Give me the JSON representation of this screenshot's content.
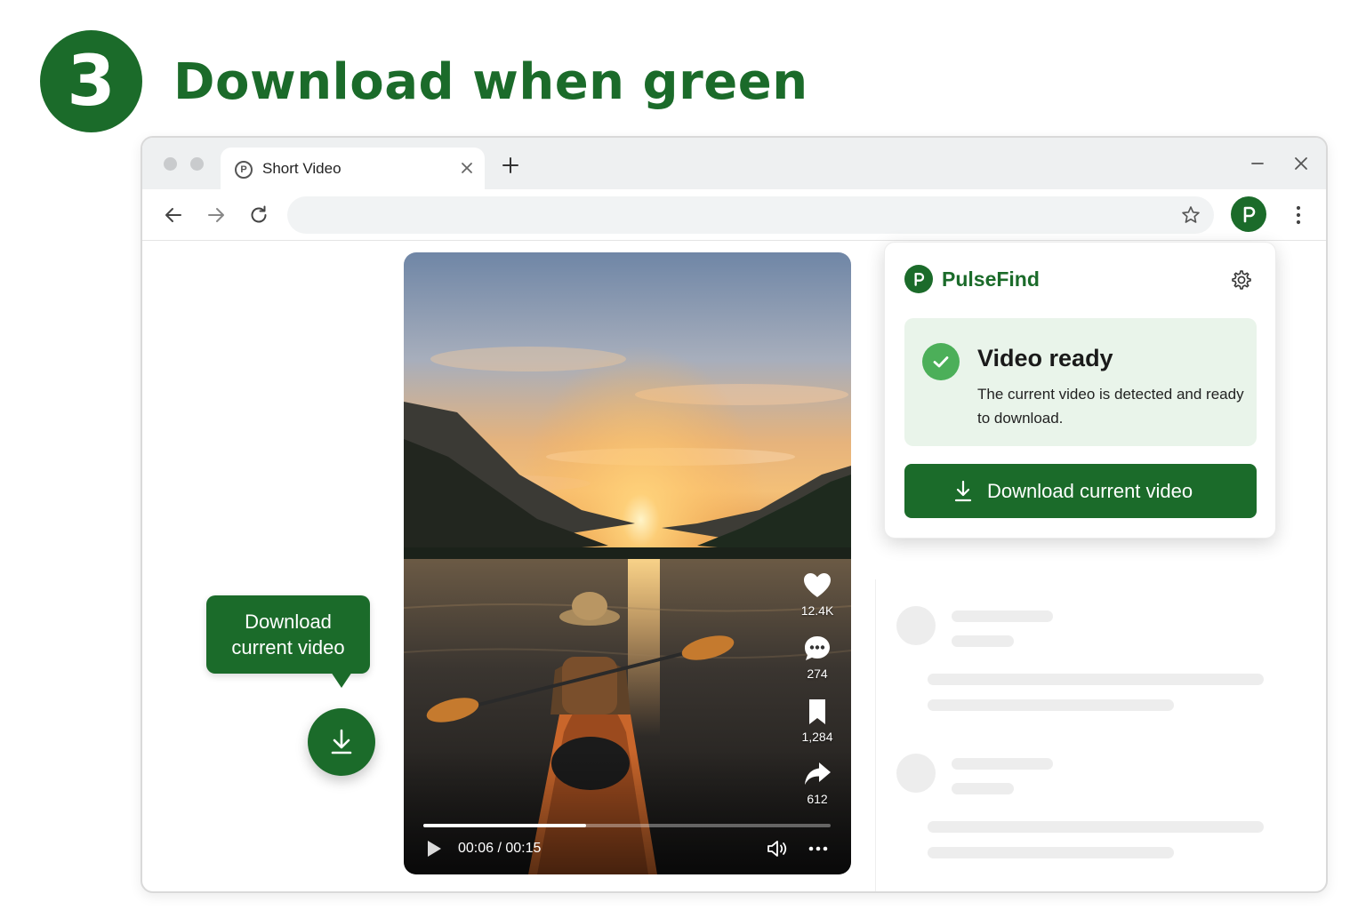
{
  "step": {
    "number": "3",
    "title": "Download when green"
  },
  "browser": {
    "tab": {
      "title": "Short Video",
      "favicon_icon": "pulsefind-logo-icon"
    },
    "toolbar": {
      "url": "",
      "extension_icon": "pulsefind-logo-icon"
    }
  },
  "video": {
    "stats": {
      "likes": "12.4K",
      "comments": "274",
      "saves": "1,284",
      "shares": "612"
    },
    "time_display": "00:06 / 00:15",
    "progress_fraction": 0.4
  },
  "tooltip": {
    "line1": "Download",
    "line2": "current video"
  },
  "popup": {
    "brand": "PulseFind",
    "status_title": "Video ready",
    "status_description": "The current video is detected and ready to download.",
    "download_button": "Download current video"
  },
  "colors": {
    "brand_green": "#1b6b2a",
    "success_green": "#4caf59",
    "ready_card_bg": "#e9f4ea"
  }
}
